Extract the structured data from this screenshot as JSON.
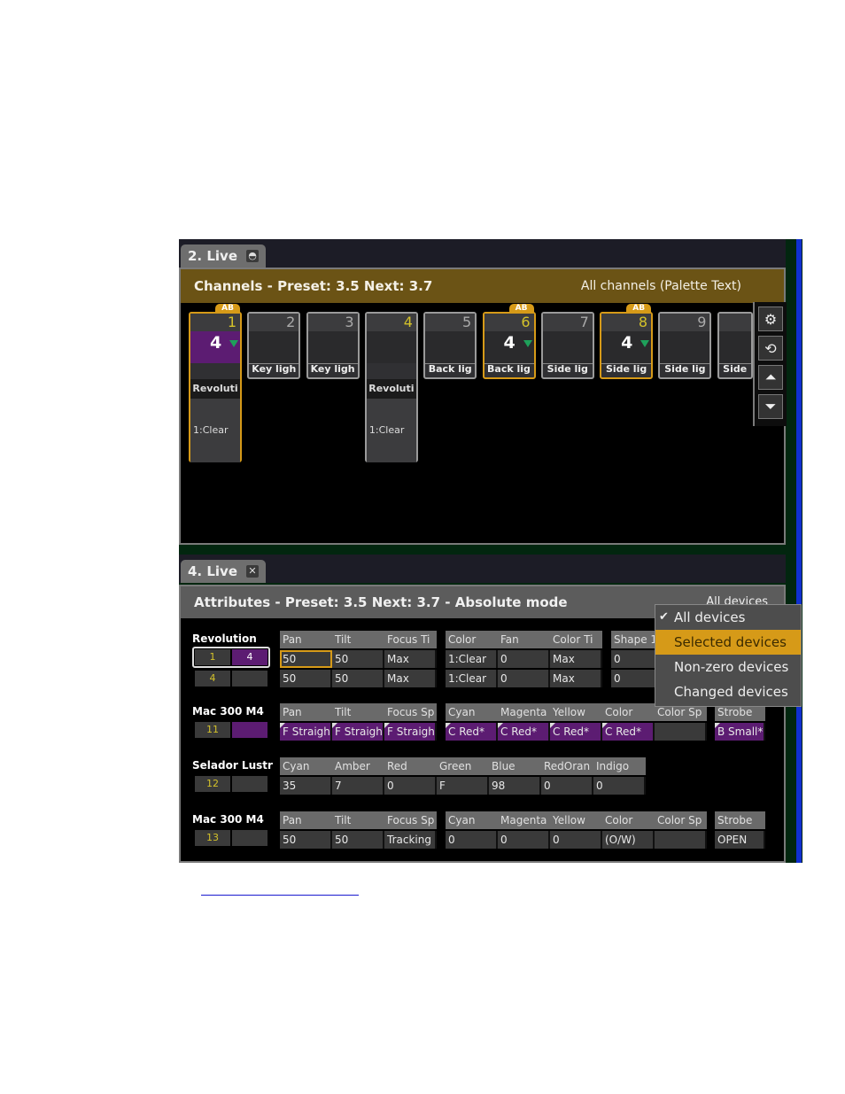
{
  "panel_top": {
    "tab_label": "2. Live",
    "tab_icon": "lock-icon",
    "header_title": "Channels - Preset: 3.5   Next: 3.7",
    "header_filter": "All channels (Palette Text)",
    "side_buttons": [
      "gear-icon",
      "rotate-icon",
      "scroll-up-icon",
      "scroll-down-icon"
    ],
    "channels": [
      {
        "num": "1",
        "ab": "AB",
        "level": "4",
        "label": "",
        "name": "Revoluti",
        "palette": "1:Clear",
        "selected": true
      },
      {
        "num": "2",
        "label": "Key ligh"
      },
      {
        "num": "3",
        "label": "Key ligh"
      },
      {
        "num": "4",
        "label": "",
        "name": "Revoluti",
        "palette": "1:Clear"
      },
      {
        "num": "5",
        "label": "Back lig"
      },
      {
        "num": "6",
        "ab": "AB",
        "level": "4",
        "label": "Back lig",
        "selected": true
      },
      {
        "num": "7",
        "label": "Side lig"
      },
      {
        "num": "8",
        "ab": "AB",
        "level": "4",
        "label": "Side lig",
        "selected": true
      },
      {
        "num": "9",
        "label": "Side lig"
      },
      {
        "num": "",
        "label": "Side"
      }
    ]
  },
  "panel_bottom": {
    "tab_label": "4. Live",
    "tab_icon": "close-icon",
    "header_title": "Attributes - Preset: 3.5 Next: 3.7 - Absolute mode",
    "header_filter": "All devices",
    "devices": [
      {
        "name": "Revolution",
        "rows": [
          [
            "1",
            "4"
          ],
          [
            "4",
            ""
          ]
        ]
      },
      {
        "name": "Mac 300 M4",
        "rows": [
          [
            "11",
            ""
          ]
        ]
      },
      {
        "name": "Selador Lustr",
        "rows": [
          [
            "12",
            ""
          ]
        ]
      },
      {
        "name": "Mac 300 M4",
        "rows": [
          [
            "13",
            ""
          ]
        ]
      }
    ],
    "revolution": {
      "g1": {
        "h": [
          "Pan",
          "Tilt",
          "Focus Ti"
        ],
        "r1": [
          "50",
          "50",
          "Max"
        ],
        "r2": [
          "50",
          "50",
          "Max"
        ]
      },
      "g2": {
        "h": [
          "Color",
          "Fan",
          "Color Ti"
        ],
        "r1": [
          "1:Clear",
          "0",
          "Max"
        ],
        "r2": [
          "1:Clear",
          "0",
          "Max"
        ]
      },
      "g3": {
        "h": [
          "Shape 1a"
        ],
        "r1": [
          "0"
        ],
        "r2": [
          "0"
        ]
      }
    },
    "mac1": {
      "g1": {
        "h": [
          "Pan",
          "Tilt",
          "Focus Sp"
        ],
        "r1": [
          "F Straigh",
          "F Straigh",
          "F Straigh"
        ]
      },
      "g2": {
        "h": [
          "Cyan",
          "Magenta",
          "Yellow",
          "Color",
          "Color Sp"
        ],
        "r1": [
          "C Red*",
          "C Red*",
          "C Red*",
          "C Red*",
          ""
        ]
      },
      "g3": {
        "h": [
          "Strobe"
        ],
        "r1": [
          "B Small*"
        ]
      }
    },
    "selador": {
      "g1": {
        "h": [
          "Cyan",
          "Amber",
          "Red",
          "Green",
          "Blue",
          "RedOran",
          "Indigo"
        ],
        "r1": [
          "35",
          "7",
          "0",
          "F",
          "98",
          "0",
          "0"
        ]
      }
    },
    "mac2": {
      "g1": {
        "h": [
          "Pan",
          "Tilt",
          "Focus Sp"
        ],
        "r1": [
          "50",
          "50",
          "Tracking"
        ]
      },
      "g2": {
        "h": [
          "Cyan",
          "Magenta",
          "Yellow",
          "Color",
          "Color Sp"
        ],
        "r1": [
          "0",
          "0",
          "0",
          "(O/W)",
          ""
        ]
      },
      "g3": {
        "h": [
          "Strobe"
        ],
        "r1": [
          "OPEN"
        ]
      }
    }
  },
  "filter_menu": {
    "items": [
      "All devices",
      "Selected devices",
      "Non-zero devices",
      "Changed devices"
    ],
    "checked": "All devices",
    "highlighted": "Selected devices",
    "check_glyph": "✔"
  },
  "colors": {
    "accent": "#d69a18",
    "purple": "#5c1c72",
    "header_brown": "#6b5315"
  }
}
